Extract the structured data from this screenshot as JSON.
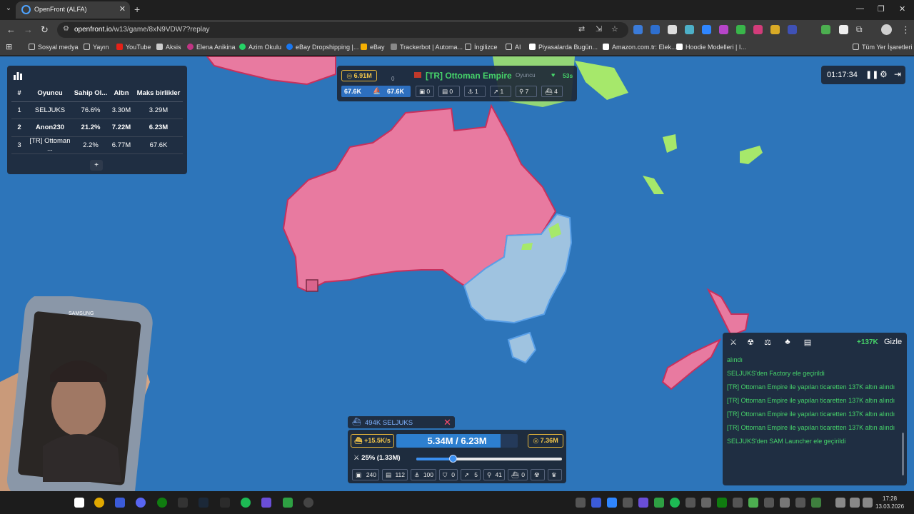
{
  "browser": {
    "tab_title": "OpenFront (ALFA)",
    "url_host": "openfront.io",
    "url_path": "/w13/game/8xN9VDW7?replay",
    "bookmarks": [
      "Sosyal medya",
      "Yayın",
      "YouTube",
      "Aksis",
      "Elena Anikina",
      "Azim Okulu",
      "eBay Dropshipping |...",
      "eBay",
      "Trackerbot | Automa...",
      "İngilizce",
      "AI",
      "Piyasalarda Bugün...",
      "Amazon.com.tr: Elek...",
      "Hoodie Modelleri | I..."
    ],
    "bookmarks_all": "Tüm Yer İşaretleri"
  },
  "leaderboard": {
    "headers": [
      "#",
      "Oyuncu",
      "Sahip Ol...",
      "Altın",
      "Maks birlikler"
    ],
    "rows": [
      {
        "rank": "1",
        "player": "SELJUKS",
        "owned": "76.6%",
        "gold": "3.30M",
        "max_troops": "3.29M"
      },
      {
        "rank": "2",
        "player": "Anon230",
        "owned": "21.2%",
        "gold": "7.22M",
        "max_troops": "6.23M"
      },
      {
        "rank": "3",
        "player": "[TR] Ottoman ...",
        "owned": "2.2%",
        "gold": "6.77M",
        "max_troops": "67.6K"
      }
    ],
    "more_label": "+"
  },
  "player_panel": {
    "gold": "6.91M",
    "alliance_count": "0",
    "name": "[TR] Ottoman Empire",
    "role": "Oyuncu",
    "timer": "53s",
    "troops": "67.6K",
    "max_troops": "67.6K",
    "stats": [
      "0",
      "0",
      "1",
      "1",
      "7",
      "4"
    ]
  },
  "game_timer": "01:17:34",
  "events": {
    "gold_gain": "+137K",
    "hide_label": "Gizle",
    "items": [
      "alındı",
      "SELJUKS'den Factory ele geçirildi",
      "[TR] Ottoman Empire ile yapılan ticaretten 137K altın alındı",
      "[TR] Ottoman Empire ile yapılan ticaretten 137K altın alındı",
      "[TR] Ottoman Empire ile yapılan ticaretten 137K altın alındı",
      "[TR] Ottoman Empire ile yapılan ticaretten 137K altın alındı",
      "SELJUKS'den SAM Launcher ele geçirildi"
    ]
  },
  "control_panel": {
    "unit_tag": "494K SELJUKS",
    "rate": "+15.5K/s",
    "troops": "5.34M / 6.23M",
    "troop_fraction": 0.857,
    "gold": "7.36M",
    "attack_ratio": "25% (1.33M)",
    "slider_fraction": 0.25,
    "buildings": [
      {
        "key": "1",
        "value": "240"
      },
      {
        "key": "2",
        "value": "112"
      },
      {
        "key": "3",
        "value": "100"
      },
      {
        "key": "4",
        "value": "0"
      },
      {
        "key": "5",
        "value": "5"
      },
      {
        "key": "6",
        "value": "41"
      },
      {
        "key": "7",
        "value": "0"
      },
      {
        "key": "8",
        "value": ""
      },
      {
        "key": "9",
        "value": ""
      }
    ]
  },
  "taskbar": {
    "time": "17:28",
    "date": "13.03.2026"
  },
  "colors": {
    "ocean": "#2d75ba",
    "enemy_territory": "#e87aa0",
    "own_territory": "#9fc3e0",
    "ally_territory": "#a6e86b",
    "accent_green": "#46d46a",
    "gold": "#f3c64a"
  }
}
